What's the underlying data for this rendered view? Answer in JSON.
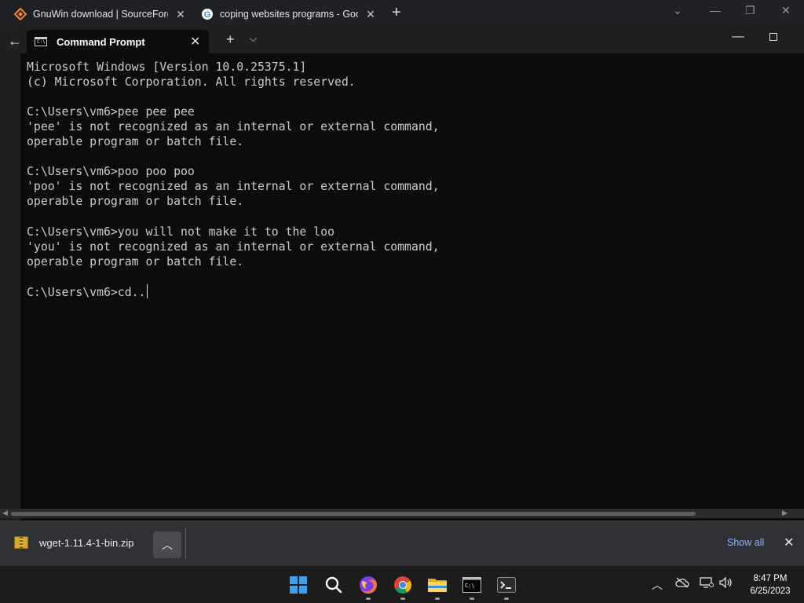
{
  "browser": {
    "tabs": [
      {
        "title": "GnuWin download | SourceForge",
        "icon": "sourceforge-icon"
      },
      {
        "title": "coping websites programs - Goo",
        "icon": "google-icon"
      }
    ]
  },
  "terminal": {
    "tab_title": "Command Prompt",
    "lines": [
      "Microsoft Windows [Version 10.0.25375.1]",
      "(c) Microsoft Corporation. All rights reserved.",
      "",
      "C:\\Users\\vm6>pee pee pee",
      "'pee' is not recognized as an internal or external command,",
      "operable program or batch file.",
      "",
      "C:\\Users\\vm6>poo poo poo",
      "'poo' is not recognized as an internal or external command,",
      "operable program or batch file.",
      "",
      "C:\\Users\\vm6>you will not make it to the loo",
      "'you' is not recognized as an internal or external command,",
      "operable program or batch file.",
      "",
      "C:\\Users\\vm6>cd.."
    ],
    "colors": {
      "background": "#0c0c0c",
      "text": "#cccccc"
    }
  },
  "downloads": {
    "file_name": "wget-1.11.4-1-bin.zip",
    "show_all_label": "Show all"
  },
  "taskbar": {
    "apps": [
      "start-icon",
      "search-icon",
      "firefox-icon",
      "chrome-icon",
      "file-explorer-icon",
      "command-prompt-icon",
      "terminal-icon"
    ],
    "time": "8:47 PM",
    "date": "6/25/2023"
  }
}
